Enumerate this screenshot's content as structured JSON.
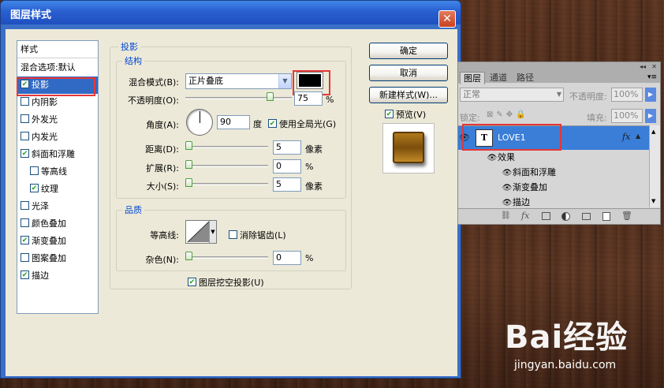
{
  "dialog": {
    "title": "图层样式",
    "close_glyph": "✕",
    "style_list": {
      "header": "样式",
      "items": [
        {
          "label": "混合选项:默认",
          "checkbox": false
        },
        {
          "label": "投影",
          "checkbox": true,
          "checked": true,
          "selected": true
        },
        {
          "label": "内阴影",
          "checkbox": true,
          "checked": false
        },
        {
          "label": "外发光",
          "checkbox": true,
          "checked": false
        },
        {
          "label": "内发光",
          "checkbox": true,
          "checked": false
        },
        {
          "label": "斜面和浮雕",
          "checkbox": true,
          "checked": true
        },
        {
          "label": "等高线",
          "checkbox": true,
          "checked": false,
          "indent": true
        },
        {
          "label": "纹理",
          "checkbox": true,
          "checked": true,
          "indent": true
        },
        {
          "label": "光泽",
          "checkbox": true,
          "checked": false
        },
        {
          "label": "颜色叠加",
          "checkbox": true,
          "checked": false
        },
        {
          "label": "渐变叠加",
          "checkbox": true,
          "checked": true
        },
        {
          "label": "图案叠加",
          "checkbox": true,
          "checked": false
        },
        {
          "label": "描边",
          "checkbox": true,
          "checked": true
        }
      ]
    },
    "drop_shadow": {
      "section_title": "投影",
      "structure_title": "结构",
      "blend_mode_label": "混合模式(B):",
      "blend_mode_value": "正片叠底",
      "shadow_color": "#000000",
      "opacity_label": "不透明度(O):",
      "opacity_value": "75",
      "opacity_unit": "%",
      "opacity_fraction": 0.75,
      "angle_label": "角度(A):",
      "angle_value": "90",
      "angle_unit": "度",
      "use_global_light_label": "使用全局光(G)",
      "use_global_light": true,
      "distance_label": "距离(D):",
      "distance_value": "5",
      "distance_unit": "像素",
      "spread_label": "扩展(R):",
      "spread_value": "0",
      "spread_unit": "%",
      "size_label": "大小(S):",
      "size_value": "5",
      "size_unit": "像素",
      "quality_title": "品质",
      "contour_label": "等高线:",
      "anti_alias_label": "消除锯齿(L)",
      "anti_alias": false,
      "noise_label": "杂色(N):",
      "noise_value": "0",
      "noise_unit": "%",
      "knockout_label": "图层挖空投影(U)",
      "knockout": true
    },
    "buttons": {
      "ok": "确定",
      "cancel": "取消",
      "new_style": "新建样式(W)...",
      "preview_label": "预览(V)",
      "preview": true
    }
  },
  "layers_panel": {
    "tabs": [
      "图层",
      "通道",
      "路径"
    ],
    "blend_mode": "正常",
    "opacity_label": "不透明度:",
    "opacity_value": "100%",
    "lock_label": "锁定:",
    "fill_label": "填充:",
    "fill_value": "100%",
    "layer_name": "LOVE1",
    "thumb_glyph": "T",
    "fx_label": "fx",
    "effects_label": "效果",
    "effects": [
      "斜面和浮雕",
      "渐变叠加",
      "描边"
    ]
  },
  "watermark": {
    "brand": "Bai经验",
    "url": "jingyan.baidu.com"
  },
  "colors": {
    "title_bar": "#2a5fd0",
    "dialog_bg": "#ece9d8",
    "selected_item": "#316ac5",
    "highlight_red": "#e63737",
    "layer_selected": "#3a7ed8"
  }
}
